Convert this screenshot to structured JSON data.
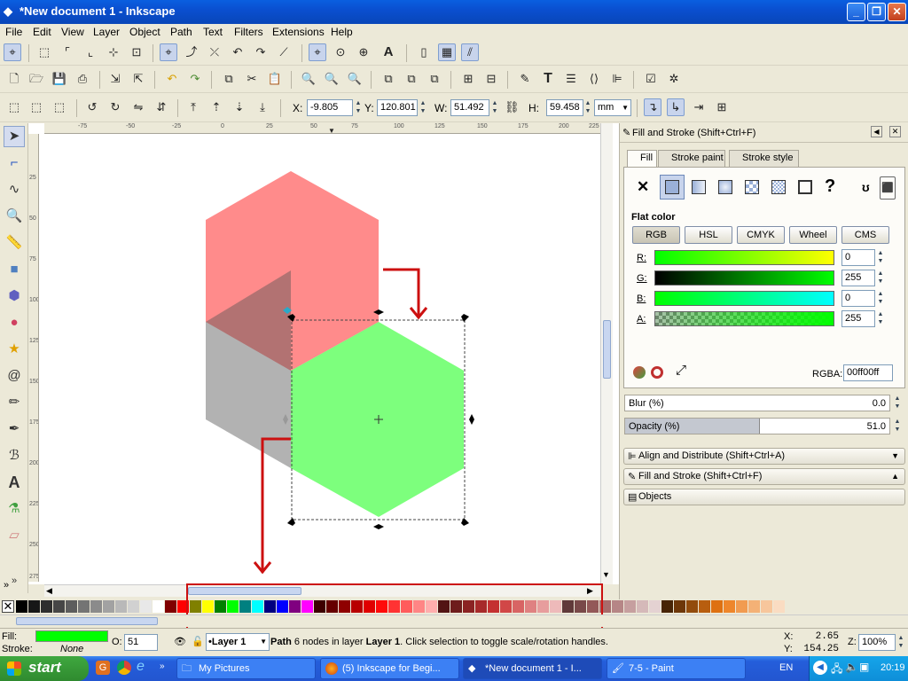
{
  "window": {
    "title": "*New document 1 - Inkscape"
  },
  "menu": [
    "File",
    "Edit",
    "View",
    "Layer",
    "Object",
    "Path",
    "Text",
    "Filters",
    "Extensions",
    "Help"
  ],
  "selectbar": {
    "x_label": "X:",
    "x_value": "-9.805",
    "y_label": "Y:",
    "y_value": "120.801",
    "w_label": "W:",
    "w_value": "51.492",
    "h_label": "H:",
    "h_value": "59.458",
    "unit": "mm"
  },
  "ruler_h": [
    "-75",
    "-50",
    "-25",
    "0",
    "25",
    "50",
    "75",
    "100",
    "125",
    "150",
    "175",
    "200",
    "225"
  ],
  "ruler_v": [
    "25",
    "50",
    "75",
    "100",
    "125",
    "150",
    "175",
    "200",
    "225",
    "250",
    "275"
  ],
  "fill_stroke": {
    "title": "Fill and Stroke (Shift+Ctrl+F)",
    "tabs": [
      "Fill",
      "Stroke paint",
      "Stroke style"
    ],
    "paint_mode": "Flat color",
    "color_modes": [
      "RGB",
      "HSL",
      "CMYK",
      "Wheel",
      "CMS"
    ],
    "channels": [
      {
        "label": "R:",
        "value": "0"
      },
      {
        "label": "G:",
        "value": "255"
      },
      {
        "label": "B:",
        "value": "0"
      },
      {
        "label": "A:",
        "value": "255"
      }
    ],
    "rgba_label": "RGBA:",
    "rgba_value": "00ff00ff",
    "blur_label": "Blur (%)",
    "blur_value": "0.0",
    "opacity_label": "Opacity (%)",
    "opacity_value": "51.0",
    "opacity_level": 0.51
  },
  "docked": [
    {
      "label": "Align and Distribute (Shift+Ctrl+A)",
      "arrow": "▼"
    },
    {
      "label": "Fill and Stroke (Shift+Ctrl+F)",
      "arrow": "▲"
    },
    {
      "label": "Objects",
      "arrow": ""
    }
  ],
  "statusbar": {
    "fill_label": "Fill:",
    "stroke_label": "Stroke:",
    "stroke_value": "None",
    "fill_color": "#00ff00",
    "opacity_label": "O:",
    "opacity_value": "51",
    "layer": "•Layer 1",
    "msg_bold1": "Path",
    "msg1": " 6 nodes in layer ",
    "msg_bold2": "Layer 1",
    "msg2": ". Click selection to toggle scale/rotation handles.",
    "cx_label": "X:",
    "cx": "2.65",
    "cy_label": "Y:",
    "cy": "154.25",
    "zoom_label": "Z:",
    "zoom": "100%"
  },
  "taskbar": {
    "start": "start",
    "buttons": [
      "My Pictures",
      "(5) Inkscape for Begi...",
      "*New document 1 - I...",
      "7-5 - Paint"
    ],
    "lang": "EN",
    "clock": "20:19"
  },
  "colors": {
    "red_hex": "#ff8080",
    "green_hex": "#7dff7d",
    "annotation": "#cc1010"
  }
}
